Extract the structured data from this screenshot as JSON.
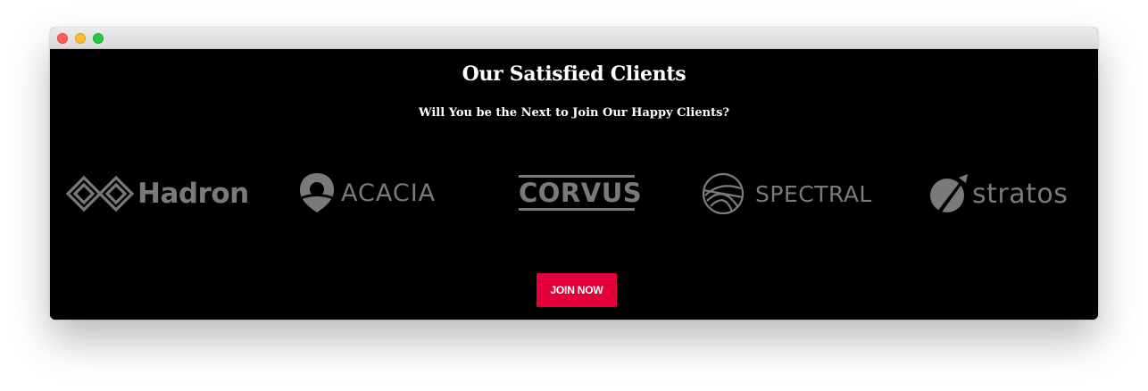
{
  "window": {
    "controls": [
      "close",
      "minimize",
      "zoom"
    ]
  },
  "section": {
    "title": "Our Satisfied Clients",
    "subtitle": "Will You be the Next to Join Our Happy Clients?"
  },
  "logos": [
    {
      "name": "Hadron",
      "icon": "hadron-diamond-icon"
    },
    {
      "name": "ACACIA",
      "icon": "acacia-shield-icon"
    },
    {
      "name": "CORVUS",
      "icon": "corvus-bars"
    },
    {
      "name": "SPECTRAL",
      "icon": "spectral-circle-icon"
    },
    {
      "name": "stratos",
      "icon": "stratos-circle-icon"
    }
  ],
  "cta": {
    "label": "JOIN NOW"
  },
  "colors": {
    "background": "#000000",
    "logo_gray": "#7a7a7a",
    "cta_red": "#e4003a",
    "text": "#ffffff"
  }
}
